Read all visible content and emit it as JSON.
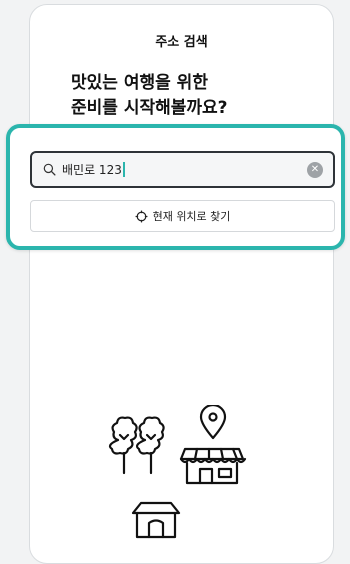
{
  "header": {
    "title": "주소 검색"
  },
  "headline": {
    "line1": "맛있는 여행을 위한",
    "line2": "준비를 시작해볼까요?"
  },
  "search": {
    "value": "배민로 123",
    "clear_icon": "clear-icon",
    "search_icon": "search-icon"
  },
  "current_location": {
    "label": "현재 위치로 찾기",
    "icon": "crosshair-icon"
  },
  "illustration": {
    "icons": [
      "tree-icon",
      "store-icon",
      "location-pin-icon",
      "house-icon"
    ]
  },
  "colors": {
    "accent": "#2bb5ad",
    "text": "#111111",
    "input_bg": "#f5f6f7",
    "border": "#2e3338"
  }
}
